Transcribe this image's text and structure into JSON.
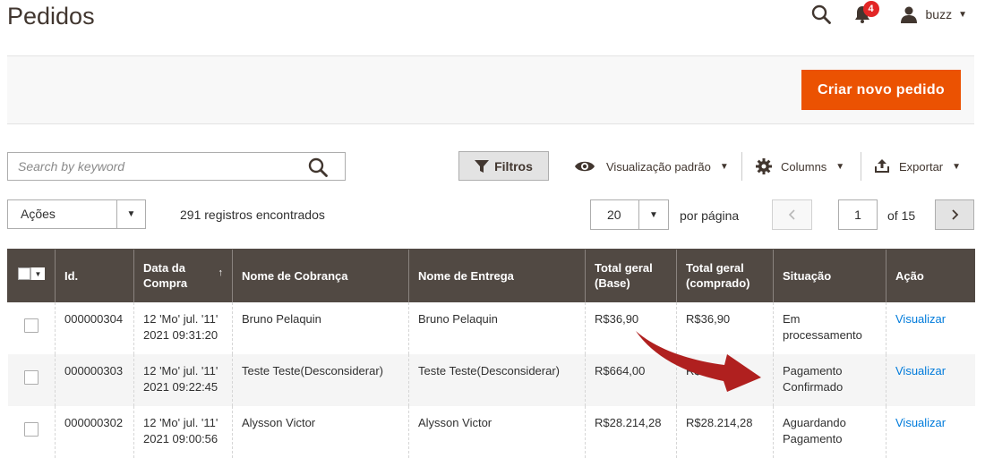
{
  "page": {
    "title": "Pedidos"
  },
  "header": {
    "notifications_count": "4",
    "user_name": "buzz"
  },
  "action_bar": {
    "create_button": "Criar novo pedido"
  },
  "search": {
    "placeholder": "Search by keyword"
  },
  "toolbar": {
    "filters": "Filtros",
    "view": "Visualização padrão",
    "columns": "Columns",
    "export": "Exportar"
  },
  "mass_actions": {
    "label": "Ações"
  },
  "records_found": "291 registros encontrados",
  "pagination": {
    "per_page_value": "20",
    "per_page_label": "por página",
    "current_page": "1",
    "total_pages_label": "of 15"
  },
  "table": {
    "headers": {
      "id": "Id.",
      "date": "Data da Compra",
      "billing": "Nome de Cobrança",
      "shipping": "Nome de Entrega",
      "total_base": "Total geral (Base)",
      "total_purchased": "Total geral (comprado)",
      "status": "Situação",
      "action": "Ação"
    },
    "rows": [
      {
        "id": "000000304",
        "date_line1": "12 'Mo' jul. '11'",
        "date_line2": "2021 09:31:20",
        "billing": "Bruno Pelaquin",
        "shipping": "Bruno Pelaquin",
        "total_base": "R$36,90",
        "total_purchased": "R$36,90",
        "status": "Em processamento",
        "action": "Visualizar"
      },
      {
        "id": "000000303",
        "date_line1": "12 'Mo' jul. '11'",
        "date_line2": "2021 09:22:45",
        "billing": "Teste Teste(Desconsiderar)",
        "shipping": "Teste Teste(Desconsiderar)",
        "total_base": "R$664,00",
        "total_purchased": "R$664,00",
        "status": "Pagamento Confirmado",
        "action": "Visualizar"
      },
      {
        "id": "000000302",
        "date_line1": "12 'Mo' jul. '11'",
        "date_line2": "2021 09:00:56",
        "billing": "Alysson Victor",
        "shipping": "Alysson Victor",
        "total_base": "R$28.214,28",
        "total_purchased": "R$28.214,28",
        "status": "Aguardando Pagamento",
        "action": "Visualizar"
      }
    ]
  },
  "colors": {
    "accent": "#eb5202",
    "header_bg": "#514943",
    "link": "#007bdb",
    "badge": "#e22626",
    "annotation_arrow": "#b0201f"
  },
  "icons": [
    "search-icon",
    "bell-icon",
    "user-icon",
    "filter-icon",
    "eye-icon",
    "gear-icon",
    "export-icon",
    "chevron-left-icon",
    "chevron-right-icon"
  ]
}
